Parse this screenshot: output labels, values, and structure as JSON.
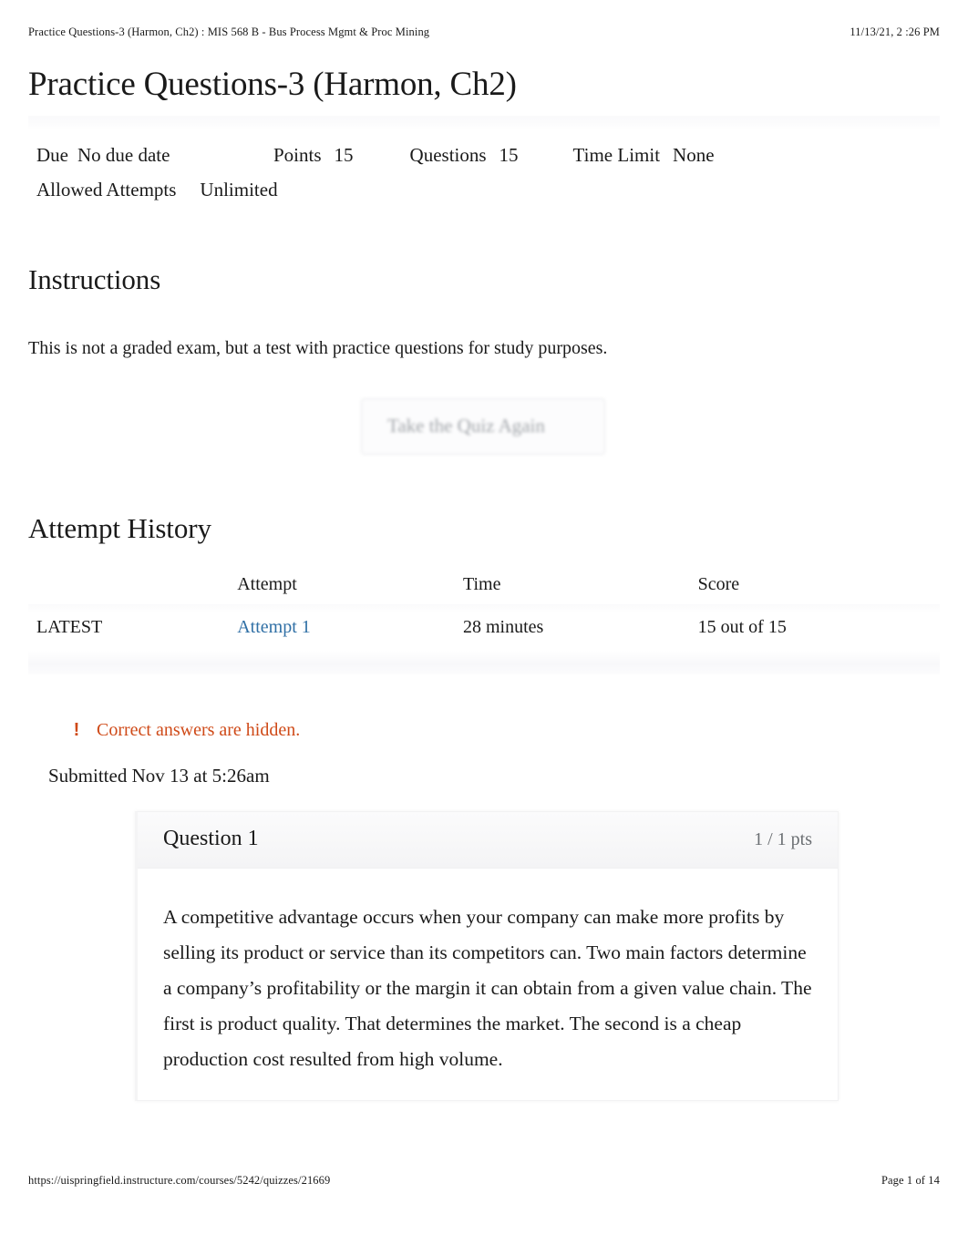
{
  "print_header": {
    "document_title": "Practice Questions-3 (Harmon, Ch2) : MIS 568 B - Bus Process Mgmt & Proc Mining",
    "timestamp": "11/13/21, 2 :26 PM"
  },
  "print_footer": {
    "url": "https://uispringfield.instructure.com/courses/5242/quizzes/21669",
    "page_indicator": "Page 1 of 14"
  },
  "quiz": {
    "title": "Practice Questions-3 (Harmon, Ch2)",
    "meta": {
      "due_label": "Due",
      "due_value": "No due date",
      "points_label": "Points",
      "points_value": "15",
      "questions_label": "Questions",
      "questions_value": "15",
      "time_limit_label": "Time Limit",
      "time_limit_value": "None",
      "allowed_attempts_label": "Allowed Attempts",
      "allowed_attempts_value": "Unlimited"
    }
  },
  "instructions": {
    "heading": "Instructions",
    "body": "This is not a graded exam, but a test with practice questions for study purposes."
  },
  "retake": {
    "label": "Take the Quiz Again"
  },
  "attempt_history": {
    "heading": "Attempt History",
    "columns": {
      "kept": "",
      "attempt": "Attempt",
      "time": "Time",
      "score": "Score"
    },
    "rows": [
      {
        "kept": "LATEST",
        "attempt": "Attempt 1",
        "time": "28 minutes",
        "score": "15 out of 15"
      }
    ]
  },
  "answers_hidden": {
    "icon": "warning-exclamation-icon",
    "glyph": "!",
    "text": "Correct answers are hidden.",
    "color": "#cf4a18"
  },
  "submission": {
    "text": "Submitted Nov 13 at 5:26am"
  },
  "question": {
    "name": "Question 1",
    "points": "1 / 1 pts",
    "body": "A competitive advantage occurs when your company can make more profits by selling its product or service than its competitors can.    Two main factors determine a company’s profitability or the margin it can obtain from a given value chain. The first is product quality. That determines the market. The second is a cheap production cost resulted from high volume."
  },
  "colors": {
    "link": "#2f6fa5",
    "warning": "#cf4a18",
    "text": "#1a1a1a",
    "muted": "#6b6f73"
  }
}
